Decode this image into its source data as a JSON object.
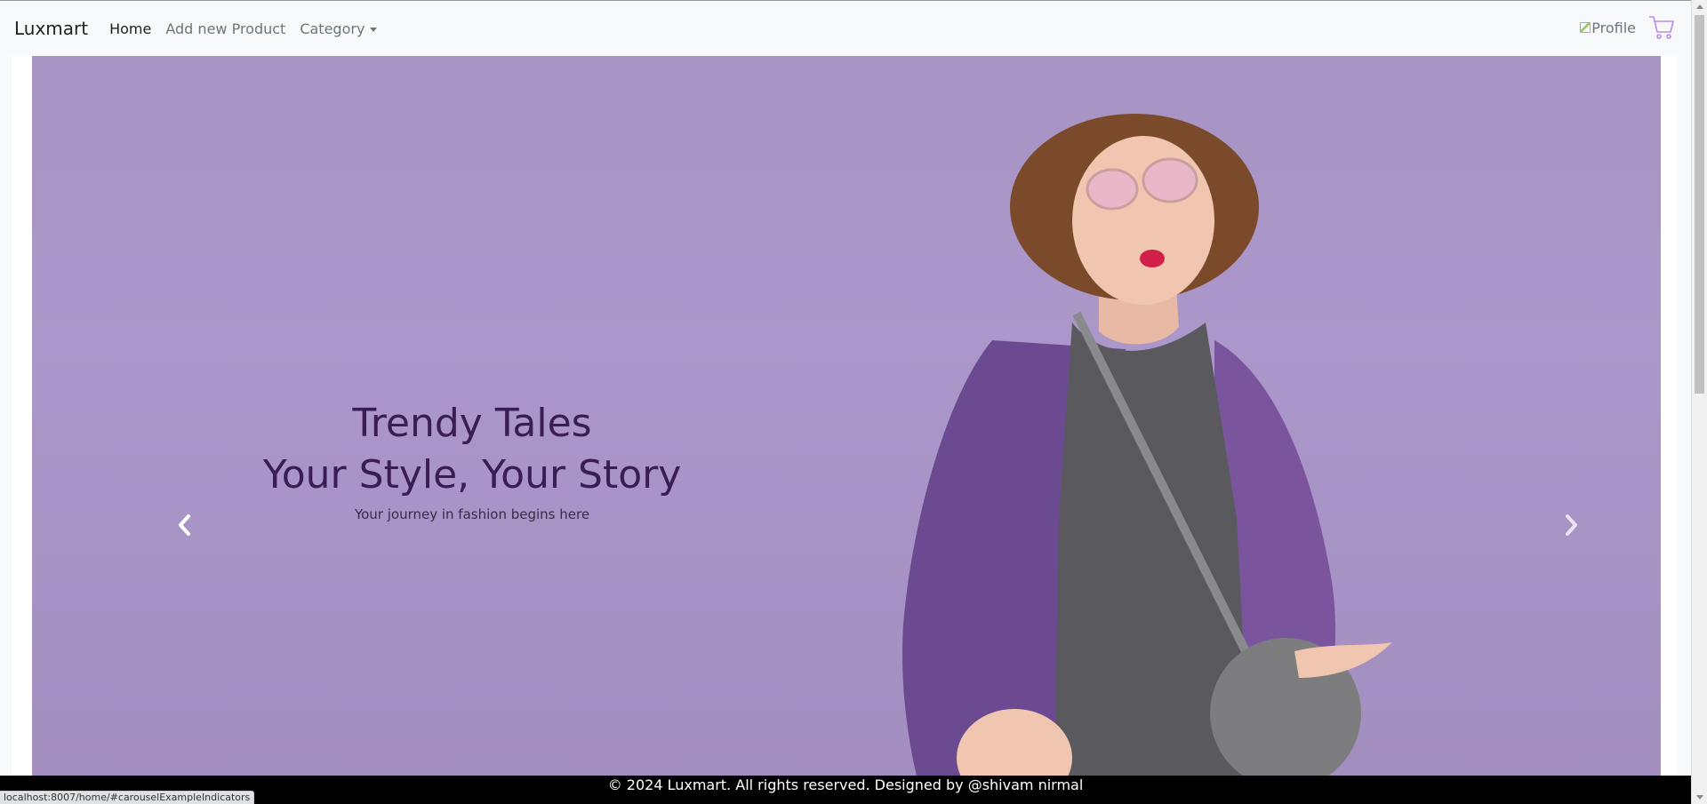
{
  "navbar": {
    "brand": "Luxmart",
    "links": [
      {
        "label": "Home",
        "active": true
      },
      {
        "label": "Add new Product",
        "active": false
      },
      {
        "label": "Category",
        "active": false,
        "dropdown": true
      }
    ],
    "profile_alt": "Profile",
    "cart_icon": "cart-icon"
  },
  "carousel": {
    "caption": {
      "title_line1": "Trendy Tales",
      "title_line2": "Your Style, Your Story",
      "subtitle": "Your journey in fashion begins here"
    },
    "prev_icon": "chevron-left-icon",
    "next_icon": "chevron-right-icon",
    "background_color": "#a794c4"
  },
  "footer": {
    "text": "© 2024 Luxmart. All rights reserved. Designed by @shivam nirmal"
  },
  "status_bar": {
    "url": "localhost:8007/home/#carouselExampleIndicators"
  },
  "colors": {
    "navbar_bg": "#f8f9fa",
    "footer_bg": "#000000",
    "caption_text": "#3a1d52",
    "cart_accent": "#b889e8"
  }
}
